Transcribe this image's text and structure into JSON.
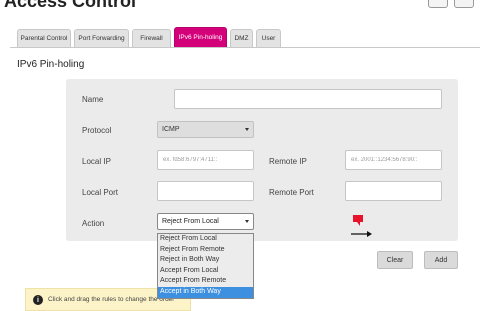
{
  "header": {
    "title": "Access Control"
  },
  "tabs": [
    {
      "label": "Parental Control"
    },
    {
      "label": "Port Forwarding"
    },
    {
      "label": "Firewall"
    },
    {
      "label": "IPv6 Pin-holing"
    },
    {
      "label": "DMZ"
    },
    {
      "label": "User"
    }
  ],
  "section": {
    "title": "IPv6 Pin-holing"
  },
  "form": {
    "name_label": "Name",
    "name_value": "",
    "protocol_label": "Protocol",
    "protocol_value": "ICMP",
    "local_ip_label": "Local IP",
    "local_ip_placeholder": "ex. fd58:6797:4711::",
    "remote_ip_label": "Remote IP",
    "remote_ip_placeholder": "ex. 2001::1234:5678:90::",
    "local_port_label": "Local Port",
    "remote_port_label": "Remote Port",
    "action_label": "Action",
    "action_value": "Reject From Local",
    "action_options": [
      "Reject From Local",
      "Reject From Remote",
      "Reject in Both Way",
      "Accept From Local",
      "Accept From Remote",
      "Accept in Both Way"
    ],
    "action_highlighted_index": 5
  },
  "buttons": {
    "clear": "Clear",
    "add": "Add"
  },
  "notice": {
    "icon": "info-icon",
    "text": "Click and drag the rules to change the order"
  },
  "colors": {
    "accent": "#d4007a",
    "dropdown_highlight": "#3d8fe0",
    "notice_bg": "#fdf3c8"
  }
}
